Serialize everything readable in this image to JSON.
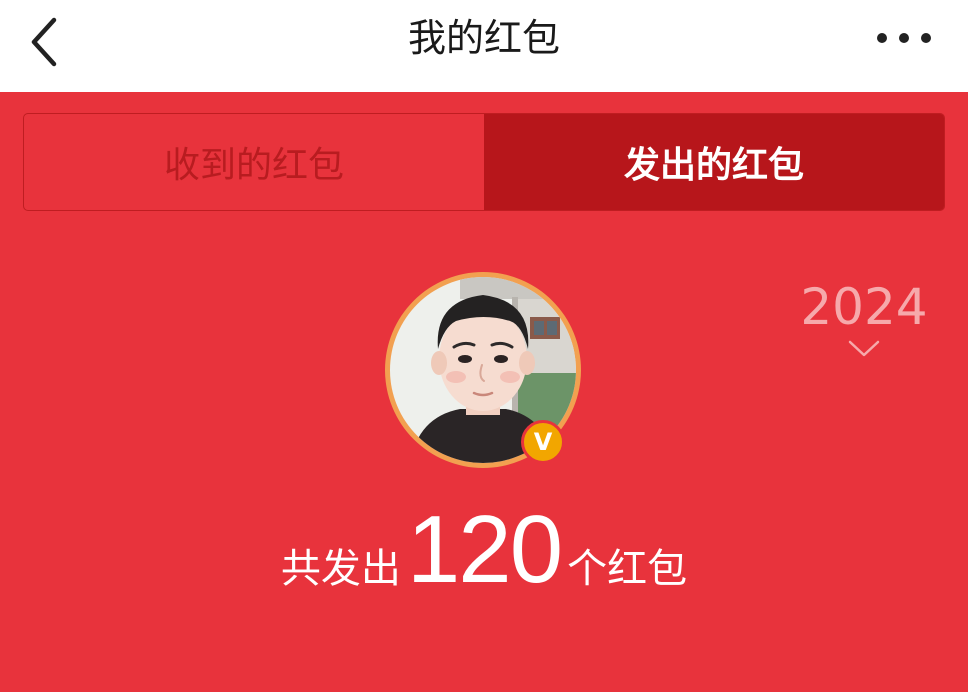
{
  "header": {
    "title": "我的红包",
    "back_icon": "chevron-left-icon",
    "more_icon": "more-horizontal-icon"
  },
  "tabs": [
    {
      "label": "收到的红包",
      "active": false
    },
    {
      "label": "发出的红包",
      "active": true
    }
  ],
  "year_picker": {
    "year": "2024",
    "icon": "chevron-down-icon"
  },
  "profile": {
    "verified_badge": "V"
  },
  "summary": {
    "prefix": "共发出",
    "count": "120",
    "suffix": "个红包"
  },
  "colors": {
    "background": "#e8333c",
    "tab_active": "#b7161b",
    "tab_inactive_text": "#b81c20",
    "year_text": "#f6a9ab",
    "avatar_ring": "#f2a050",
    "badge": "#f2a600"
  }
}
